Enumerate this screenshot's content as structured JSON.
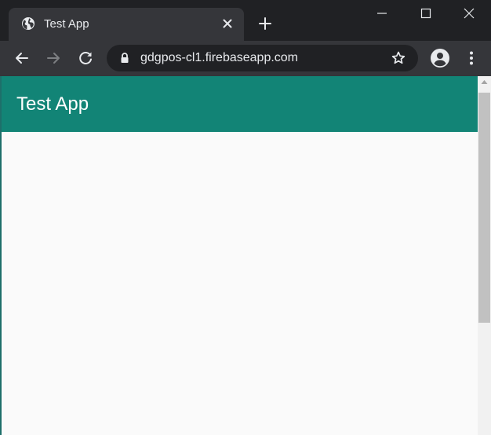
{
  "browser": {
    "tab": {
      "title": "Test App",
      "favicon": "globe-icon"
    },
    "omnibox": {
      "url": "gdgpos-cl1.firebaseapp.com"
    },
    "colors": {
      "frame": "#202124",
      "toolbar": "#35363a",
      "icon": "#e8eaed"
    }
  },
  "app": {
    "title": "Test App",
    "colors": {
      "primary": "#128476",
      "background": "#fafafa",
      "title_text": "#ffffff"
    }
  }
}
